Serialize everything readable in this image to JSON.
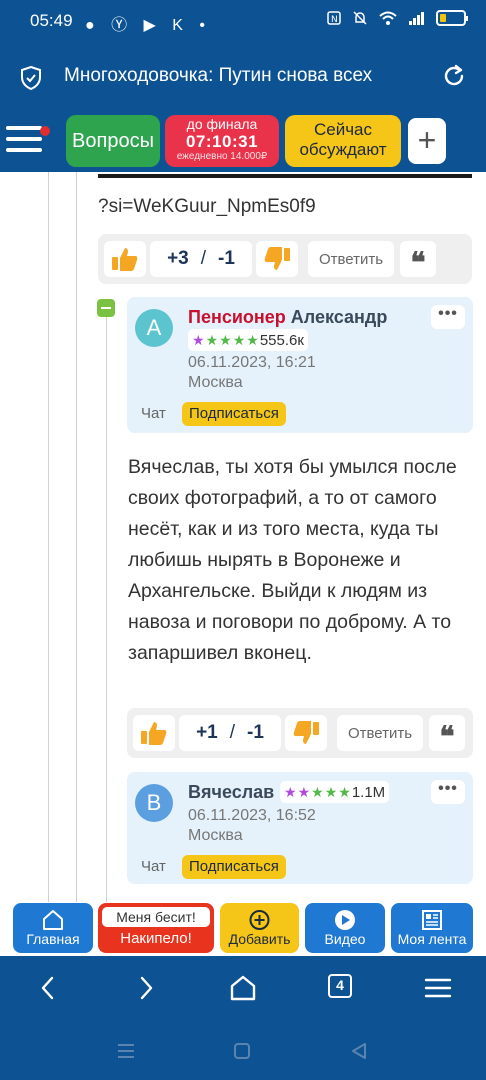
{
  "status_bar": {
    "time": "05:49",
    "left_icons": [
      "chat-bubble-icon",
      "yandex-icon",
      "youtube-icon",
      "k-icon",
      "dot-icon"
    ],
    "right_icons": [
      "nfc-icon",
      "mute-icon",
      "wifi-icon",
      "signal-icon",
      "battery-icon"
    ],
    "left_icons_glyphs": "● Ⓨ ▶ K •"
  },
  "browser": {
    "title": "Многоходовочка: Путин снова всех",
    "tabs_count": "4"
  },
  "site_header": {
    "questions_label": "Вопросы",
    "countdown_label": "до финала",
    "countdown_time": "07:10:31",
    "countdown_sub": "ежедневно 14.000₽",
    "discussing_label_1": "Сейчас",
    "discussing_label_2": "обсуждают",
    "plus_label": "+"
  },
  "thread": {
    "prev_comment_tail": "?si=WeKGuur_NpmEs0f9",
    "prev_votes": {
      "up": "+3",
      "sep": "/",
      "down": "-1"
    },
    "reply_label": "Ответить",
    "quote_glyph": "❝",
    "comment1": {
      "avatar_letter": "А",
      "author_first": "Пенсионер",
      "author_last": "Александр",
      "rating": "555.6к",
      "date": "06.11.2023, 16:21",
      "location": "Москва",
      "chat_label": "Чат",
      "subscribe_label": "Подписаться",
      "menu_glyph": "•••",
      "body": "Вячеслав, ты хотя бы умылся после своих фотографий, а то от самого несёт, как и из того места, куда ты любишь нырять в Воронеже и Архангельске. Выйди к людям из навоза и поговори по доброму. А то запаршивел вконец.",
      "votes": {
        "up": "+1",
        "sep": "/",
        "down": "-1"
      }
    },
    "comment2": {
      "avatar_letter": "В",
      "author": "Вячеслав",
      "rating": "1.1M",
      "date": "06.11.2023, 16:52",
      "location": "Москва",
      "chat_label": "Чат",
      "subscribe_label": "Подписаться",
      "menu_glyph": "•••"
    }
  },
  "site_nav": {
    "home": "Главная",
    "rage_top": "Меня бесит!",
    "rage_bottom": "Накипело!",
    "add": "Добавить",
    "video": "Видео",
    "feed": "Моя лента"
  },
  "colors": {
    "brand_blue": "#0d5394",
    "green": "#2ea44f",
    "red": "#e8334a",
    "yellow": "#f5c518",
    "card_bg": "#e5f2fb"
  }
}
